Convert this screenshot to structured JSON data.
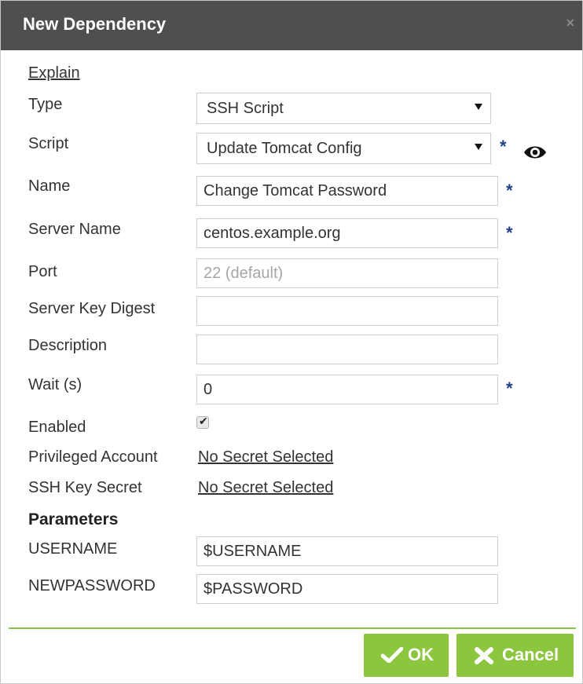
{
  "dialog": {
    "title": "New Dependency",
    "close": "×"
  },
  "form": {
    "explain": "Explain",
    "type": {
      "label": "Type",
      "value": "SSH Script"
    },
    "script": {
      "label": "Script",
      "value": "Update Tomcat Config",
      "required": "*"
    },
    "name": {
      "label": "Name",
      "value": "Change Tomcat Password",
      "required": "*"
    },
    "server_name": {
      "label": "Server Name",
      "value": "centos.example.org",
      "required": "*"
    },
    "port": {
      "label": "Port",
      "placeholder": "22 (default)"
    },
    "server_key_digest": {
      "label": "Server Key Digest",
      "value": ""
    },
    "description": {
      "label": "Description",
      "value": ""
    },
    "wait": {
      "label": "Wait (s)",
      "value": "0",
      "required": "*"
    },
    "enabled": {
      "label": "Enabled",
      "checked": true
    },
    "privileged_account": {
      "label": "Privileged Account",
      "value": "No Secret Selected"
    },
    "ssh_key_secret": {
      "label": "SSH Key Secret",
      "value": "No Secret Selected"
    }
  },
  "parameters": {
    "title": "Parameters",
    "items": [
      {
        "label": "USERNAME",
        "value": "$USERNAME"
      },
      {
        "label": "NEWPASSWORD",
        "value": "$PASSWORD"
      }
    ]
  },
  "footer": {
    "ok_label": "OK",
    "cancel_label": "Cancel"
  },
  "icons": {
    "eye": "eye-icon",
    "check": "checkmark-icon",
    "x": "x-icon",
    "caret": "chevron-down-icon"
  }
}
